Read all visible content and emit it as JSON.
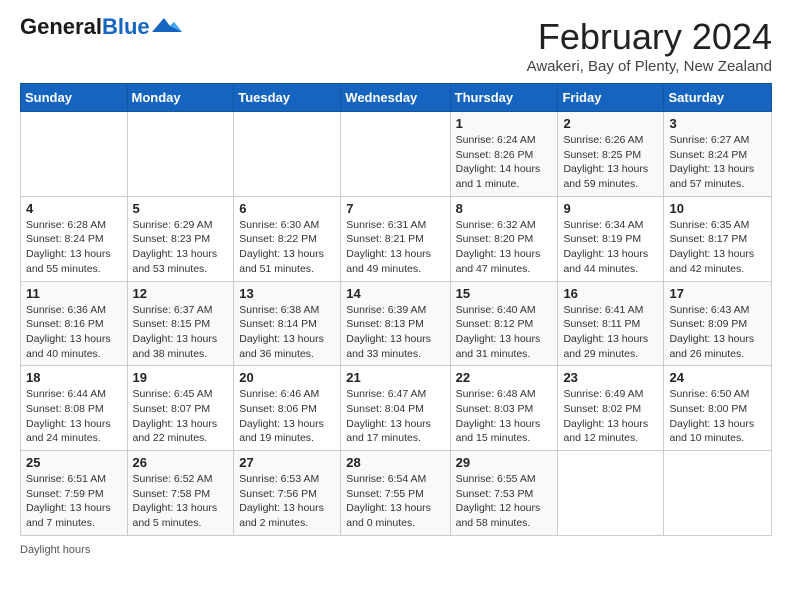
{
  "header": {
    "logo_general": "General",
    "logo_blue": "Blue",
    "month": "February 2024",
    "location": "Awakeri, Bay of Plenty, New Zealand"
  },
  "days_of_week": [
    "Sunday",
    "Monday",
    "Tuesday",
    "Wednesday",
    "Thursday",
    "Friday",
    "Saturday"
  ],
  "weeks": [
    [
      {
        "day": "",
        "info": ""
      },
      {
        "day": "",
        "info": ""
      },
      {
        "day": "",
        "info": ""
      },
      {
        "day": "",
        "info": ""
      },
      {
        "day": "1",
        "info": "Sunrise: 6:24 AM\nSunset: 8:26 PM\nDaylight: 14 hours\nand 1 minute."
      },
      {
        "day": "2",
        "info": "Sunrise: 6:26 AM\nSunset: 8:25 PM\nDaylight: 13 hours\nand 59 minutes."
      },
      {
        "day": "3",
        "info": "Sunrise: 6:27 AM\nSunset: 8:24 PM\nDaylight: 13 hours\nand 57 minutes."
      }
    ],
    [
      {
        "day": "4",
        "info": "Sunrise: 6:28 AM\nSunset: 8:24 PM\nDaylight: 13 hours\nand 55 minutes."
      },
      {
        "day": "5",
        "info": "Sunrise: 6:29 AM\nSunset: 8:23 PM\nDaylight: 13 hours\nand 53 minutes."
      },
      {
        "day": "6",
        "info": "Sunrise: 6:30 AM\nSunset: 8:22 PM\nDaylight: 13 hours\nand 51 minutes."
      },
      {
        "day": "7",
        "info": "Sunrise: 6:31 AM\nSunset: 8:21 PM\nDaylight: 13 hours\nand 49 minutes."
      },
      {
        "day": "8",
        "info": "Sunrise: 6:32 AM\nSunset: 8:20 PM\nDaylight: 13 hours\nand 47 minutes."
      },
      {
        "day": "9",
        "info": "Sunrise: 6:34 AM\nSunset: 8:19 PM\nDaylight: 13 hours\nand 44 minutes."
      },
      {
        "day": "10",
        "info": "Sunrise: 6:35 AM\nSunset: 8:17 PM\nDaylight: 13 hours\nand 42 minutes."
      }
    ],
    [
      {
        "day": "11",
        "info": "Sunrise: 6:36 AM\nSunset: 8:16 PM\nDaylight: 13 hours\nand 40 minutes."
      },
      {
        "day": "12",
        "info": "Sunrise: 6:37 AM\nSunset: 8:15 PM\nDaylight: 13 hours\nand 38 minutes."
      },
      {
        "day": "13",
        "info": "Sunrise: 6:38 AM\nSunset: 8:14 PM\nDaylight: 13 hours\nand 36 minutes."
      },
      {
        "day": "14",
        "info": "Sunrise: 6:39 AM\nSunset: 8:13 PM\nDaylight: 13 hours\nand 33 minutes."
      },
      {
        "day": "15",
        "info": "Sunrise: 6:40 AM\nSunset: 8:12 PM\nDaylight: 13 hours\nand 31 minutes."
      },
      {
        "day": "16",
        "info": "Sunrise: 6:41 AM\nSunset: 8:11 PM\nDaylight: 13 hours\nand 29 minutes."
      },
      {
        "day": "17",
        "info": "Sunrise: 6:43 AM\nSunset: 8:09 PM\nDaylight: 13 hours\nand 26 minutes."
      }
    ],
    [
      {
        "day": "18",
        "info": "Sunrise: 6:44 AM\nSunset: 8:08 PM\nDaylight: 13 hours\nand 24 minutes."
      },
      {
        "day": "19",
        "info": "Sunrise: 6:45 AM\nSunset: 8:07 PM\nDaylight: 13 hours\nand 22 minutes."
      },
      {
        "day": "20",
        "info": "Sunrise: 6:46 AM\nSunset: 8:06 PM\nDaylight: 13 hours\nand 19 minutes."
      },
      {
        "day": "21",
        "info": "Sunrise: 6:47 AM\nSunset: 8:04 PM\nDaylight: 13 hours\nand 17 minutes."
      },
      {
        "day": "22",
        "info": "Sunrise: 6:48 AM\nSunset: 8:03 PM\nDaylight: 13 hours\nand 15 minutes."
      },
      {
        "day": "23",
        "info": "Sunrise: 6:49 AM\nSunset: 8:02 PM\nDaylight: 13 hours\nand 12 minutes."
      },
      {
        "day": "24",
        "info": "Sunrise: 6:50 AM\nSunset: 8:00 PM\nDaylight: 13 hours\nand 10 minutes."
      }
    ],
    [
      {
        "day": "25",
        "info": "Sunrise: 6:51 AM\nSunset: 7:59 PM\nDaylight: 13 hours\nand 7 minutes."
      },
      {
        "day": "26",
        "info": "Sunrise: 6:52 AM\nSunset: 7:58 PM\nDaylight: 13 hours\nand 5 minutes."
      },
      {
        "day": "27",
        "info": "Sunrise: 6:53 AM\nSunset: 7:56 PM\nDaylight: 13 hours\nand 2 minutes."
      },
      {
        "day": "28",
        "info": "Sunrise: 6:54 AM\nSunset: 7:55 PM\nDaylight: 13 hours\nand 0 minutes."
      },
      {
        "day": "29",
        "info": "Sunrise: 6:55 AM\nSunset: 7:53 PM\nDaylight: 12 hours\nand 58 minutes."
      },
      {
        "day": "",
        "info": ""
      },
      {
        "day": "",
        "info": ""
      }
    ]
  ],
  "footer": "Daylight hours"
}
